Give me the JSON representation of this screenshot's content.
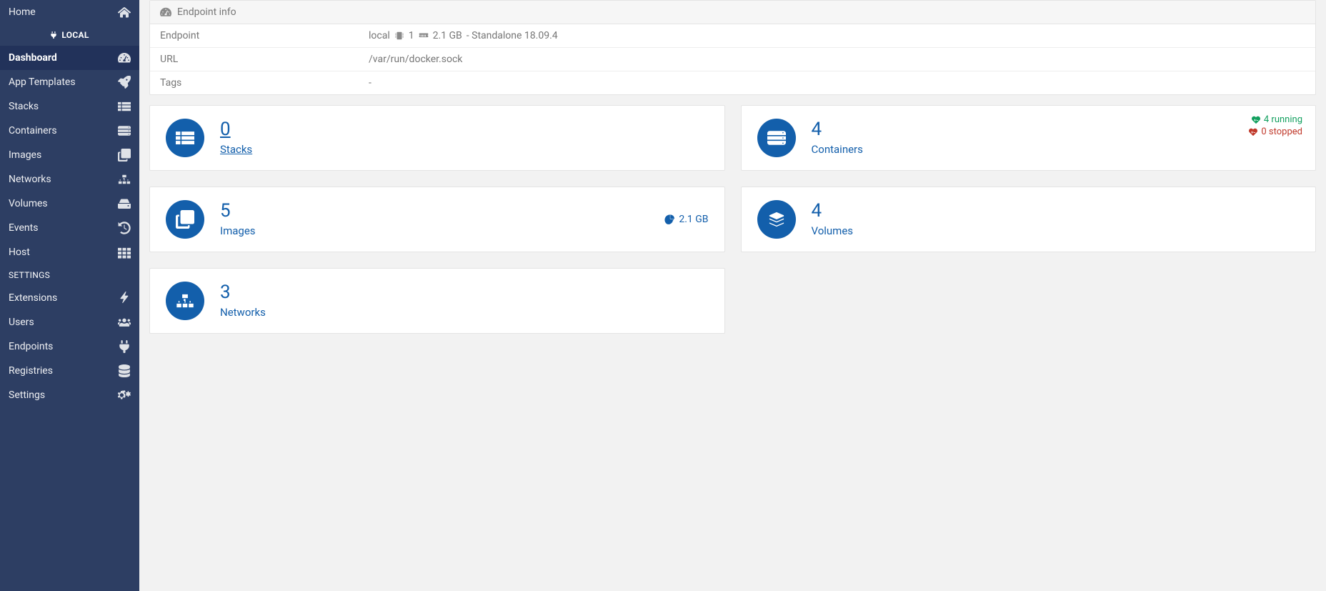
{
  "sidebar": {
    "home": "Home",
    "env": "LOCAL",
    "items": [
      {
        "label": "Dashboard"
      },
      {
        "label": "App Templates"
      },
      {
        "label": "Stacks"
      },
      {
        "label": "Containers"
      },
      {
        "label": "Images"
      },
      {
        "label": "Networks"
      },
      {
        "label": "Volumes"
      },
      {
        "label": "Events"
      },
      {
        "label": "Host"
      }
    ],
    "settings_title": "SETTINGS",
    "settings": [
      {
        "label": "Extensions"
      },
      {
        "label": "Users"
      },
      {
        "label": "Endpoints"
      },
      {
        "label": "Registries"
      },
      {
        "label": "Settings"
      }
    ]
  },
  "endpoint_panel": {
    "title": "Endpoint info",
    "rows": {
      "endpoint_label": "Endpoint",
      "endpoint_name": "local",
      "cpu": "1",
      "ram": "2.1 GB",
      "mode": "- Standalone 18.09.4",
      "url_label": "URL",
      "url_value": "/var/run/docker.sock",
      "tags_label": "Tags",
      "tags_value": "-"
    }
  },
  "tiles": {
    "stacks": {
      "count": "0",
      "label": "Stacks"
    },
    "containers": {
      "count": "4",
      "label": "Containers",
      "running": "4 running",
      "stopped": "0 stopped"
    },
    "images": {
      "count": "5",
      "label": "Images",
      "size": "2.1 GB"
    },
    "volumes": {
      "count": "4",
      "label": "Volumes"
    },
    "networks": {
      "count": "3",
      "label": "Networks"
    }
  }
}
